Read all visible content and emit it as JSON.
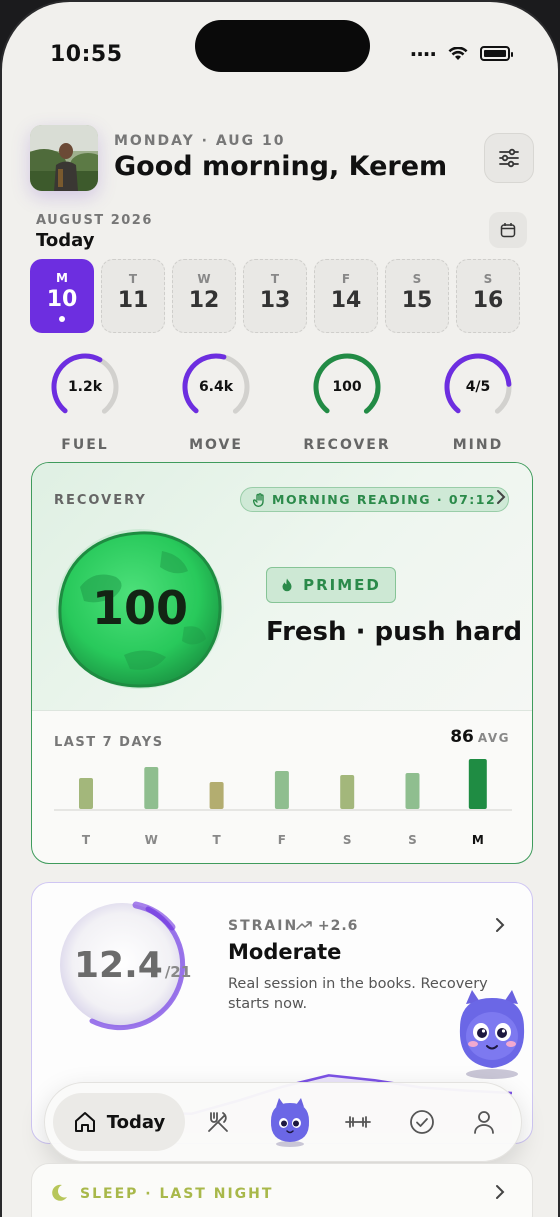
{
  "status_bar": {
    "time": "10:55"
  },
  "header": {
    "date_line": "MONDAY · AUG 10",
    "greeting": "Good morning, Kerem"
  },
  "calendar": {
    "month_label": "AUGUST 2026",
    "today_label": "Today",
    "days": [
      {
        "letter": "M",
        "num": "10",
        "selected": true
      },
      {
        "letter": "T",
        "num": "11"
      },
      {
        "letter": "W",
        "num": "12"
      },
      {
        "letter": "T",
        "num": "13"
      },
      {
        "letter": "F",
        "num": "14"
      },
      {
        "letter": "S",
        "num": "15"
      },
      {
        "letter": "S",
        "num": "16"
      }
    ]
  },
  "rings": [
    {
      "value": "1.2k",
      "label": "FUEL",
      "progress": 0.6,
      "color": "#6d2ee0"
    },
    {
      "value": "6.4k",
      "label": "MOVE",
      "progress": 0.55,
      "color": "#6d2ee0"
    },
    {
      "value": "100",
      "label": "RECOVER",
      "progress": 1.0,
      "color": "#228b45"
    },
    {
      "value": "4/5",
      "label": "MIND",
      "progress": 0.8,
      "color": "#6d2ee0"
    }
  ],
  "recovery": {
    "title": "RECOVERY",
    "morning_reading": "MORNING READING · 07:12",
    "score": "100",
    "badge": "PRIMED",
    "headline": "Fresh · push hard",
    "last7_label": "LAST 7 DAYS",
    "avg_value": "86",
    "avg_label": "AVG",
    "chart_data": {
      "type": "bar",
      "categories": [
        "T",
        "W",
        "T",
        "F",
        "S",
        "S",
        "M"
      ],
      "values": [
        81,
        92,
        77,
        88,
        84,
        86,
        100
      ],
      "highlight_index": 6,
      "colors": [
        "#a3b77b",
        "#8fbe8f",
        "#b3ad70",
        "#8fbe8f",
        "#a3b77b",
        "#8fbe8f",
        "#1f8c43"
      ]
    }
  },
  "strain": {
    "value": "12.4",
    "max": "/21",
    "label": "STRAIN",
    "delta": "+2.6",
    "title": "Moderate",
    "description": "Real session in the books. Recovery starts now.",
    "trend": [
      0.1,
      0.12,
      0.15,
      0.14,
      0.3,
      0.48,
      0.62,
      0.56,
      0.47,
      0.43,
      0.4
    ]
  },
  "nav": {
    "today_label": "Today",
    "items": [
      "home-icon",
      "fork-knife-icon",
      "mascot-icon",
      "dumbbell-icon",
      "check-circle-icon",
      "profile-icon"
    ]
  },
  "sleep": {
    "label": "SLEEP · LAST NIGHT"
  }
}
